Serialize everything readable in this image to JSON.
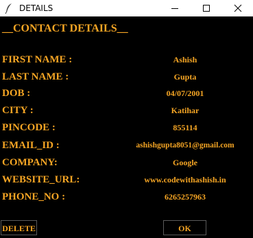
{
  "window": {
    "title": "DETAILS",
    "icon": "feather-icon"
  },
  "heading": "__CONTACT DETAILS__",
  "fields": [
    {
      "label": "FIRST NAME :",
      "value": "Ashish"
    },
    {
      "label": "LAST NAME :",
      "value": "Gupta"
    },
    {
      "label": "DOB :",
      "value": "04/07/2001"
    },
    {
      "label": "CITY :",
      "value": "Katihar"
    },
    {
      "label": "PINCODE :",
      "value": "855114"
    },
    {
      "label": "EMAIL_ID :",
      "value": "ashishgupta8051@gmail.com"
    },
    {
      "label": "COMPANY:",
      "value": "Google"
    },
    {
      "label": "WEBSITE_URL:",
      "value": "www.codewithashish.in"
    },
    {
      "label": "PHONE_NO :",
      "value": "6265257963"
    }
  ],
  "buttons": {
    "delete": "DELETE",
    "ok": "OK"
  },
  "colors": {
    "background": "#000000",
    "text_accent": "#f5a524",
    "titlebar": "#ffffff"
  }
}
